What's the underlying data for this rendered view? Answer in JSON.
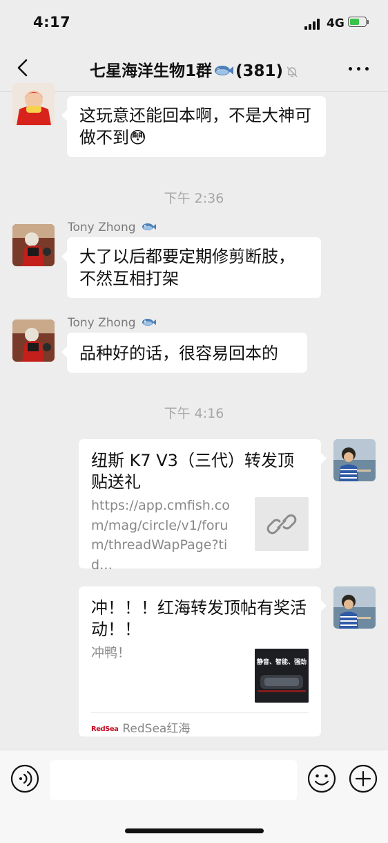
{
  "status_bar": {
    "time": "4:17",
    "network": "4G"
  },
  "header": {
    "title": "七星海洋生物1群",
    "member_count": "(381)",
    "title_emoji": "fish-emoji",
    "muted_icon": "bell-off-icon",
    "back_icon": "chevron-left-icon",
    "more_icon": "more-dots-icon"
  },
  "messages": [
    {
      "type": "text",
      "side": "left",
      "text": "这玩意还能回本啊，不是大神可做不到😳",
      "avatar": "child-red-coat-avatar"
    },
    {
      "type": "timestamp",
      "text": "下午 2:36"
    },
    {
      "type": "text",
      "side": "left",
      "sender": "Tony Zhong",
      "text": "大了以后都要定期修剪断肢，不然互相打架",
      "avatar": "costume-avatar"
    },
    {
      "type": "text",
      "side": "left",
      "sender": "Tony Zhong",
      "text": "品种好的话，很容易回本的",
      "avatar": "costume-avatar"
    },
    {
      "type": "timestamp",
      "text": "下午 4:16"
    },
    {
      "type": "link-card",
      "side": "right",
      "title": "纽斯 K7 V3（三代）转发顶贴送礼",
      "description": "https://app.cmfish.com/mag/circle/v1/forum/threadWapPage?tid…",
      "thumbnail": "link-icon",
      "avatar": "girl-by-sea-avatar"
    },
    {
      "type": "link-card",
      "side": "right",
      "title": "冲！！！红海转发顶帖有奖活动！！",
      "description": "冲鸭！",
      "thumbnail_text": "静音、智能、强劲",
      "source_logo": "RedSea",
      "source": "RedSea红海",
      "avatar": "girl-by-sea-avatar"
    }
  ],
  "input_bar": {
    "voice_icon": "voice-icon",
    "emoji_icon": "emoji-icon",
    "plus_icon": "plus-icon",
    "input_value": ""
  },
  "colors": {
    "background": "#ededed",
    "bubble": "#ffffff",
    "link_text": "#888888",
    "accent": "#3ac24b"
  }
}
